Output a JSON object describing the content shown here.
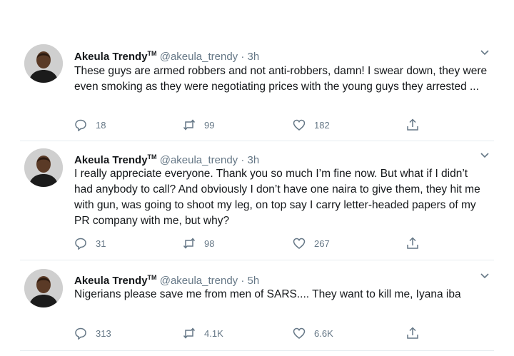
{
  "tweets": [
    {
      "name": "Akeula Trendy",
      "tm": "TM",
      "handle": "@akeula_trendy",
      "dot": "·",
      "time": "3h",
      "text": "These guys are armed robbers and not anti-robbers, damn! I swear down, they were even smoking as they were negotiating prices with the young guys they arrested ...",
      "replies": "18",
      "retweets": "99",
      "likes": "182"
    },
    {
      "name": "Akeula Trendy",
      "tm": "TM",
      "handle": "@akeula_trendy",
      "dot": "·",
      "time": "3h",
      "text": "I really appreciate everyone. Thank you so much I’m fine now. But what if I didn’t had anybody to call? And obviously I don’t have one naira to give them, they hit me with gun, was going to shoot my leg, on top say I carry letter-headed papers of my PR company with me, but why?",
      "replies": "31",
      "retweets": "98",
      "likes": "267"
    },
    {
      "name": "Akeula Trendy",
      "tm": "TM",
      "handle": "@akeula_trendy",
      "dot": "·",
      "time": "5h",
      "text": "Nigerians please save me from men of SARS.... They want to kill me, Iyana iba",
      "replies": "313",
      "retweets": "4.1K",
      "likes": "6.6K"
    }
  ],
  "icons": {
    "reply": "reply-icon",
    "retweet": "retweet-icon",
    "like": "heart-icon",
    "share": "share-icon",
    "more": "chevron-down-icon"
  },
  "colors": {
    "text": "#14171a",
    "secondary": "#657786",
    "separator": "#e6ecf0",
    "background": "#ffffff"
  }
}
